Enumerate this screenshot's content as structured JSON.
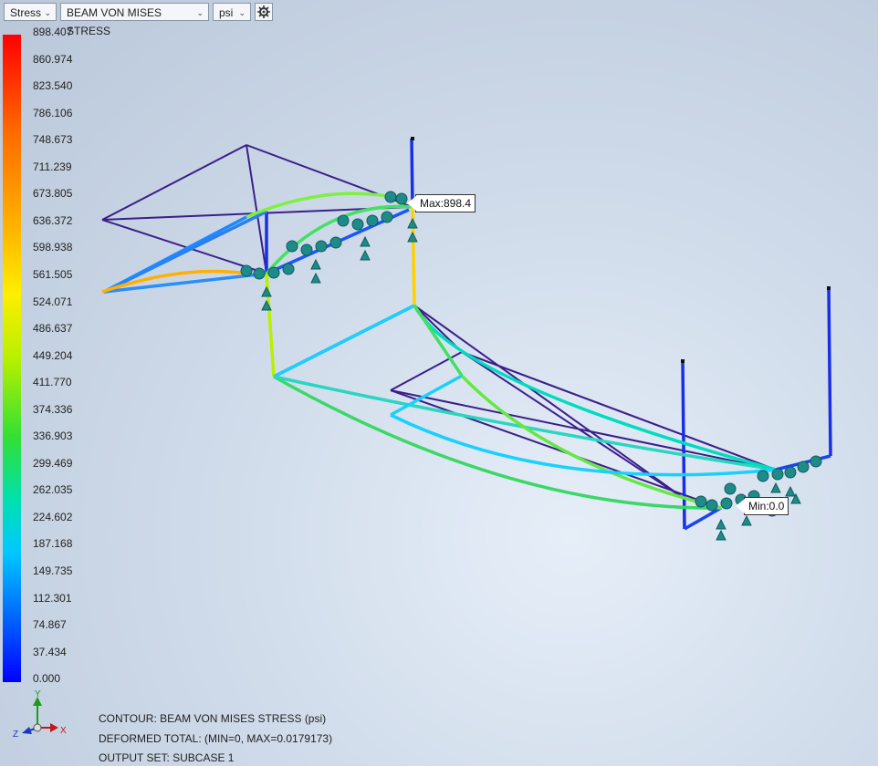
{
  "toolbar": {
    "result_type": "Stress",
    "result_measure": "BEAM VON MISES STRESS",
    "unit": "psi"
  },
  "legend": {
    "ticks": [
      "898.407",
      "860.974",
      "823.540",
      "786.106",
      "748.673",
      "711.239",
      "673.805",
      "636.372",
      "598.938",
      "561.505",
      "524.071",
      "486.637",
      "449.204",
      "411.770",
      "374.336",
      "336.903",
      "299.469",
      "262.035",
      "224.602",
      "187.168",
      "149.735",
      "112.301",
      "74.867",
      "37.434",
      "0.000"
    ],
    "colors": [
      "#ff0000",
      "#0000ff"
    ]
  },
  "callouts": {
    "max": "Max:898.4",
    "min": "Min:0.0"
  },
  "status": {
    "contour": "CONTOUR: BEAM VON MISES STRESS (psi)",
    "deformed": "DEFORMED TOTAL: (MIN=0, MAX=0.0179173)",
    "output_set": "OUTPUT SET: SUBCASE 1"
  },
  "triad": {
    "x": "X",
    "y": "Y",
    "z": "Z"
  }
}
